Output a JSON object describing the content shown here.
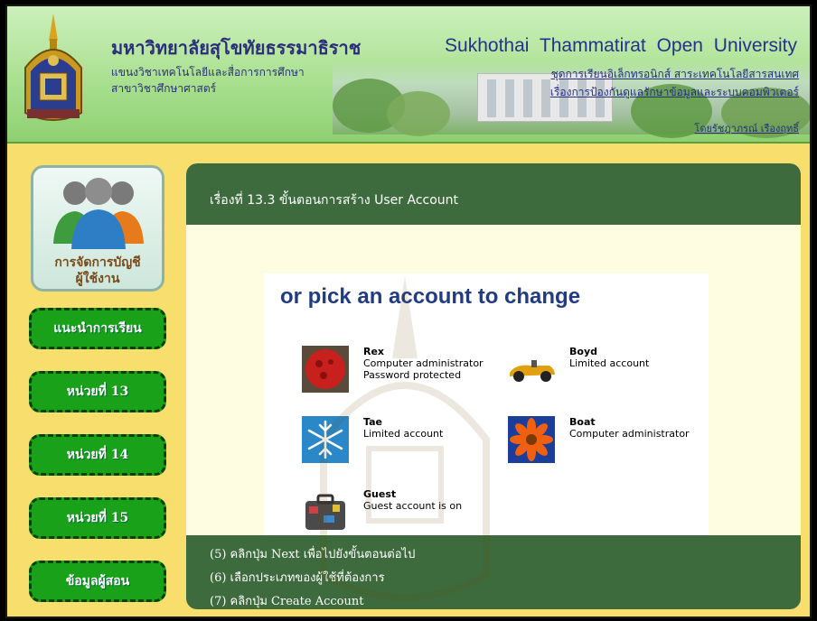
{
  "header": {
    "title_th": "มหาวิทยาลัยสุโขทัยธรรมาธิราช",
    "dept_th": "แขนงวิชาเทคโนโลยีและสื่อการการศึกษา",
    "branch_th": "สาขาวิชาศึกษาศาสตร์",
    "title_en": "Sukhothai Thammatirat Open University",
    "series_th": "ชุดการเรียนอิเล็กทรอนิกส์ สาระเทคโนโลยีสารสนเทศ",
    "topic_th": "เรื่องการป้องกันดูแลรักษาข้อมูลและระบบคอมพิวเตอร์",
    "author_th": "โดยรัชฎาภรณ์ เรืองฤทธิ์"
  },
  "sidebar": {
    "user_card_label_1": "การจัดการบัญชี",
    "user_card_label_2": "ผู้ใช้งาน",
    "items": [
      {
        "label": "แนะนำการเรียน"
      },
      {
        "label": "หน่วยที่ 13"
      },
      {
        "label": "หน่วยที่ 14"
      },
      {
        "label": "หน่วยที่ 15"
      },
      {
        "label": "ข้อมูลผู้สอน"
      }
    ]
  },
  "panel": {
    "title": "เรื่องที่ 13.3 ขั้นตอนการสร้าง User Account",
    "screenshot": {
      "heading": "or pick an account to change",
      "accounts": [
        {
          "name": "Rex",
          "line1": "Computer administrator",
          "line2": "Password protected",
          "icon": "red-ball-icon"
        },
        {
          "name": "Boyd",
          "line1": "Limited account",
          "line2": "",
          "icon": "race-car-icon"
        },
        {
          "name": "Tae",
          "line1": "Limited account",
          "line2": "",
          "icon": "snowflake-icon"
        },
        {
          "name": "Boat",
          "line1": "Computer administrator",
          "line2": "",
          "icon": "flower-icon"
        },
        {
          "name": "Guest",
          "line1": "Guest account is on",
          "line2": "",
          "icon": "suitcase-icon"
        }
      ]
    },
    "steps": [
      "(5) คลิกปุ่ม Next  เพื่อไปยังขั้นตอนต่อไป",
      "(6) เลือกประเภทของผู้ใช้ที่ต้องการ",
      "(7) คลิกปุ่ม Create Account"
    ]
  },
  "colors": {
    "page_bg": "#f8de6c",
    "panel_header": "#3d6b3d",
    "nav_button": "#1aa11a",
    "heading_blue": "#233c80"
  }
}
